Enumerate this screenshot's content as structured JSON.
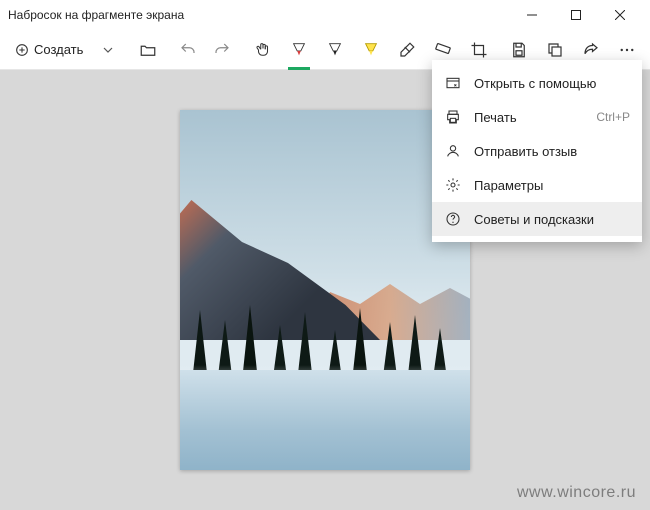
{
  "window": {
    "title": "Набросок на фрагменте экрана"
  },
  "toolbar": {
    "create_label": "Создать"
  },
  "menu": {
    "open_with": "Открыть с помощью",
    "print": "Печать",
    "print_shortcut": "Ctrl+P",
    "feedback": "Отправить отзыв",
    "settings": "Параметры",
    "tips": "Советы и подсказки"
  },
  "watermark": "www.wincore.ru"
}
